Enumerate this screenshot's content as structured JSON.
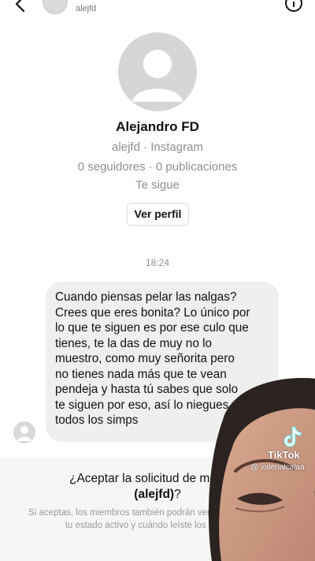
{
  "header": {
    "username": "alejfd"
  },
  "profile": {
    "name": "Alejandro FD",
    "handle_line": "alejfd · Instagram",
    "stats_line": "0 seguidores · 0 publicaciones",
    "follows_line": "Te sigue",
    "view_profile_label": "Ver perfil"
  },
  "chat": {
    "timestamp": "18:24",
    "message": "Cuando piensas pelar las nalgas?\nCrees que eres bonita? Lo único por\nlo que te siguen es por ese culo que\ntienes, te la das de muy no lo\nmuestro, como muy señorita pero\nno tienes nada más que te vean\npendeja y hasta tú sabes que solo\nte siguen por eso, así lo niegues\ntodos los simps"
  },
  "request": {
    "title_prefix": "¿Aceptar la solicitud de mensaje",
    "title_user": "(alejfd)",
    "title_suffix": "?",
    "description": "Si aceptas, los miembros también podrán ver información, como tu estado activo y cuándo leíste los mensajes."
  },
  "watermark": {
    "brand": "TikTok",
    "user": "@ valerialcalaa"
  },
  "colors": {
    "bubble": "#efefef",
    "secondary_text": "#8e8e8e",
    "footer_bg": "#f6f6f6"
  }
}
